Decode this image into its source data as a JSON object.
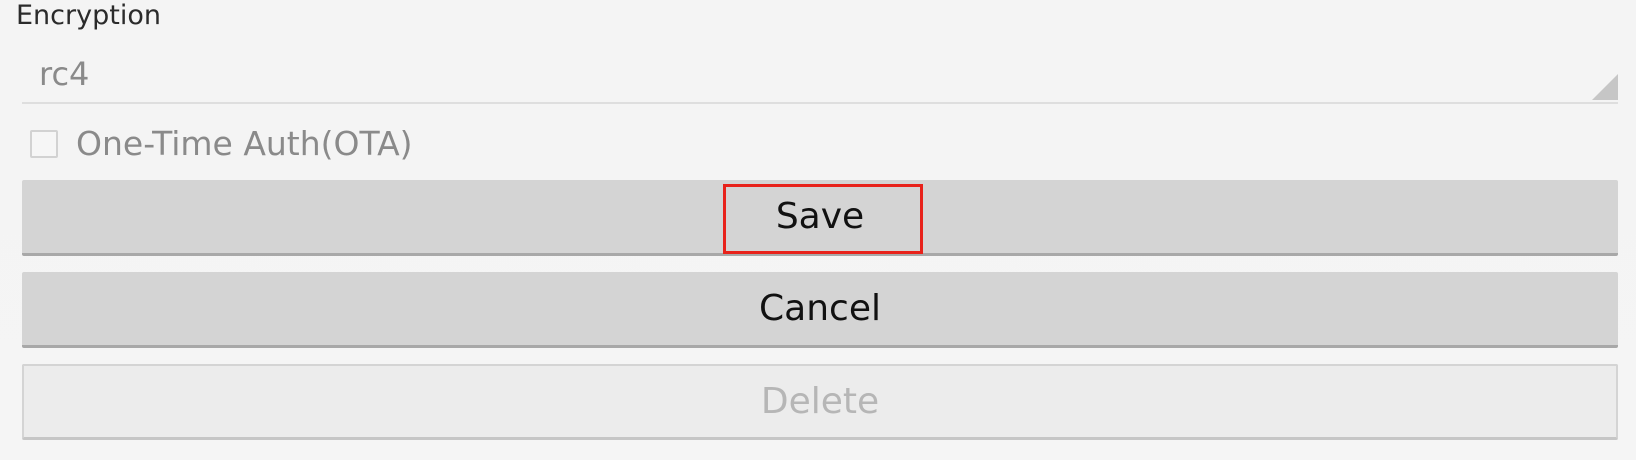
{
  "encryption": {
    "label": "Encryption",
    "value": "rc4"
  },
  "ota": {
    "label": "One-Time Auth(OTA)",
    "checked": false
  },
  "buttons": {
    "save": "Save",
    "cancel": "Cancel",
    "delete": "Delete"
  },
  "colors": {
    "highlight": "#e8221b"
  }
}
